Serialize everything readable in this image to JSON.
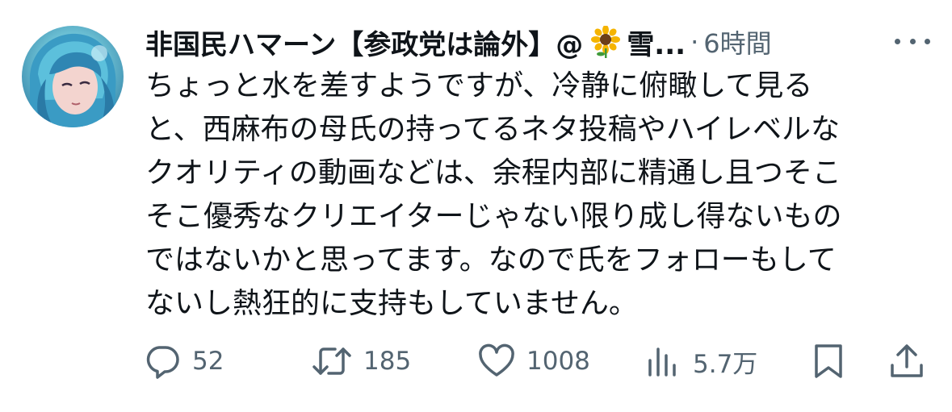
{
  "tweet": {
    "display_name": "非国民ハマーン【参政党は論外】@",
    "emoji": "sunflower",
    "name_tail": "雪...",
    "separator": "·",
    "time": "6時間",
    "more_icon": "more-dots-icon",
    "lines": [
      "ちょっと水を差すようですが、冷静に俯瞰して見る",
      "と、西麻布の母氏の持ってるネタ投稿やハイレベルな",
      "クオリティの動画などは、余程内部に精通し且つそこ",
      "そこ優秀なクリエイターじゃない限り成し得ないもの",
      "ではないかと思ってます。なので氏をフォローもして",
      "ないし熱狂的に支持もしていません。"
    ]
  },
  "actions": {
    "reply": {
      "icon": "reply-icon",
      "count": "52"
    },
    "retweet": {
      "icon": "retweet-icon",
      "count": "185"
    },
    "like": {
      "icon": "heart-icon",
      "count": "1008"
    },
    "views": {
      "icon": "views-chart-icon",
      "count": "5.7万"
    },
    "bookmark": {
      "icon": "bookmark-icon"
    },
    "share": {
      "icon": "share-icon"
    }
  },
  "colors": {
    "text": "#0f1419",
    "secondary": "#536471",
    "background": "#ffffff"
  }
}
